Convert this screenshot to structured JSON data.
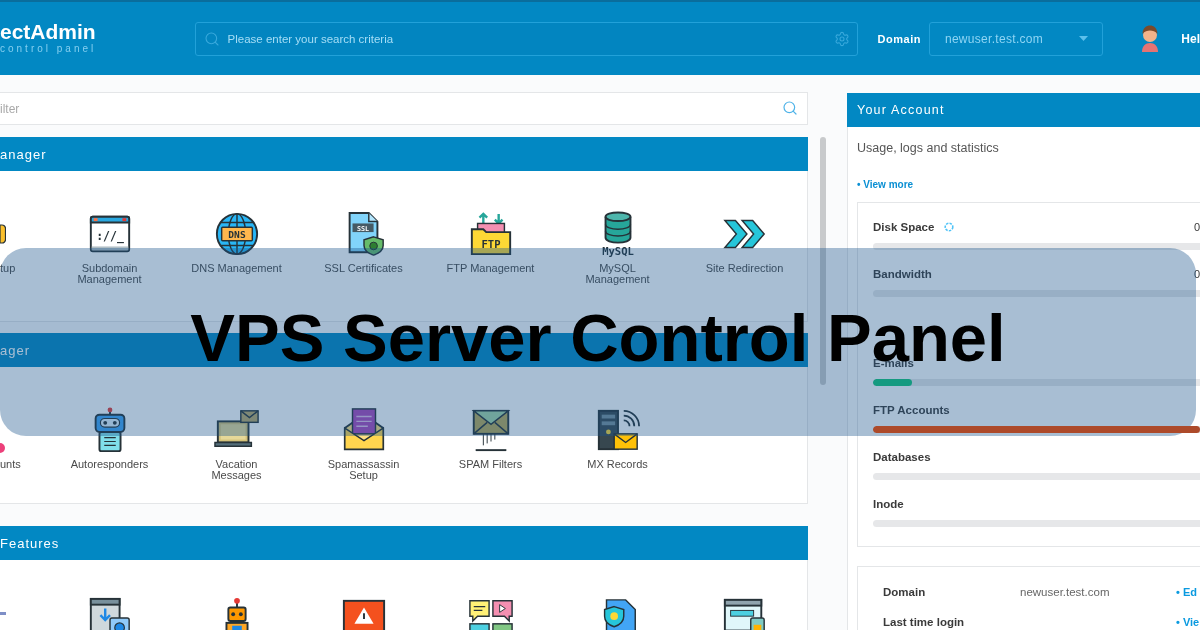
{
  "header": {
    "logo": {
      "name": "ectAdmin",
      "tagline": "control panel"
    },
    "search": {
      "placeholder": "Please enter your search criteria"
    },
    "domain": {
      "label": "Domain",
      "value": "newuser.test.com"
    },
    "greeting": "Hel"
  },
  "filter": {
    "placeholder": "ilter"
  },
  "sections": [
    {
      "title": "anager",
      "items": [
        {
          "kind": "edge_yellow",
          "label": "tup"
        },
        {
          "kind": "browser",
          "label": "Subdomain Management",
          "icon_text": "://_"
        },
        {
          "kind": "globe",
          "label": "DNS Management",
          "icon_text": "DNS"
        },
        {
          "kind": "certificate",
          "label": "SSL Certificates",
          "icon_text": "SSL"
        },
        {
          "kind": "folder",
          "label": "FTP Management",
          "icon_text": "FTP"
        },
        {
          "kind": "database",
          "label": "MySQL Management",
          "icon_text": "MySQL"
        },
        {
          "kind": "chevrons",
          "label": "Site Redirection"
        }
      ]
    },
    {
      "title": "ager",
      "items": [
        {
          "kind": "edge_pink",
          "label": "unts"
        },
        {
          "kind": "robot",
          "label": "Autoresponders"
        },
        {
          "kind": "laptop",
          "label": "Vacation Messages"
        },
        {
          "kind": "envelope_letter",
          "label": "Spamassassin Setup"
        },
        {
          "kind": "envelope_stand",
          "label": "SPAM Filters"
        },
        {
          "kind": "server",
          "label": "MX Records"
        }
      ]
    },
    {
      "title": "Features",
      "items": [
        {
          "kind": "edge_blue"
        },
        {
          "kind": "browser_download"
        },
        {
          "kind": "robot_orange"
        },
        {
          "kind": "warning_screen"
        },
        {
          "kind": "chat_bubbles"
        },
        {
          "kind": "shield_document"
        },
        {
          "kind": "browser_lock"
        }
      ]
    }
  ],
  "account": {
    "title": "Your Account",
    "subtitle": "Usage, logs and statistics",
    "link": "• View more",
    "stats": [
      {
        "label": "Disk Space",
        "value": "0",
        "refresh": true
      },
      {
        "label": "Bandwidth",
        "value": "0",
        "refresh": false
      },
      {
        "label": "E-mails",
        "refresh": false,
        "level": 0.12,
        "color": "#159a80"
      },
      {
        "label": "FTP Accounts",
        "refresh": false,
        "level": 1,
        "color": "#ad4a2a"
      },
      {
        "label": "Databases",
        "refresh": false
      },
      {
        "label": "Inode",
        "refresh": false
      }
    ],
    "details": [
      {
        "label": "Domain",
        "value": "newuser.test.com",
        "link": "• Ed"
      },
      {
        "label": "Last time login",
        "link": "• Vie"
      }
    ]
  },
  "banner": {
    "title": "VPS Server Control Panel"
  }
}
